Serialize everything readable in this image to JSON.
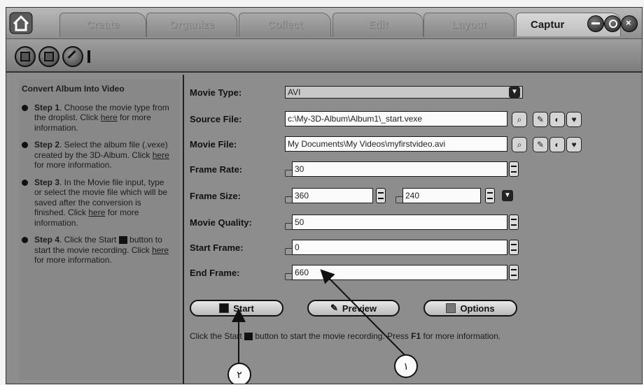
{
  "tabs": [
    {
      "label": "Create"
    },
    {
      "label": "Organize"
    },
    {
      "label": "Collect"
    },
    {
      "label": "Edit"
    },
    {
      "label": "Layout"
    },
    {
      "label": "Captur"
    }
  ],
  "help": {
    "title": "Convert Album Into Video",
    "steps": [
      {
        "head": "Step 1",
        "pre": ". Choose the movie type from the droplist. Click ",
        "link": "here",
        "post": " for more information."
      },
      {
        "head": "Step 2",
        "pre": ". Select the album file (.vexe) created by the 3D-Album. Click ",
        "link": "here",
        "post": " for more information."
      },
      {
        "head": "Step 3",
        "pre": ". In the Movie file input, type or select the movie file which will be saved after the conversion is finished. Click ",
        "link": "here",
        "post": " for more information."
      },
      {
        "head": "Step 4",
        "pre": ". Click the Start ",
        "post2": " button to start the movie recording. Click ",
        "link": "here",
        "post": " for more information."
      }
    ]
  },
  "form": {
    "movie_type_label": "Movie Type:",
    "movie_type_value": "AVI",
    "source_file_label": "Source File:",
    "source_file_value": "c:\\My-3D-Album\\Album1\\_start.vexe",
    "movie_file_label": "Movie File:",
    "movie_file_value": "My Documents\\My Videos\\myfirstvideo.avi",
    "frame_rate_label": "Frame Rate:",
    "frame_rate_value": "30",
    "frame_size_label": "Frame Size:",
    "frame_width_value": "360",
    "frame_height_value": "240",
    "movie_quality_label": "Movie Quality:",
    "movie_quality_value": "50",
    "start_frame_label": "Start Frame:",
    "start_frame_value": "0",
    "end_frame_label": "End Frame:",
    "end_frame_value": "660"
  },
  "buttons": {
    "start": "Start",
    "preview": "Preview",
    "options": "Options"
  },
  "status": {
    "pre": "Click the Start ",
    "mid": " button to start the movie recording. Press ",
    "key": "F1",
    "post": " for more information."
  },
  "annotations": {
    "one": "١",
    "two": "٢"
  }
}
